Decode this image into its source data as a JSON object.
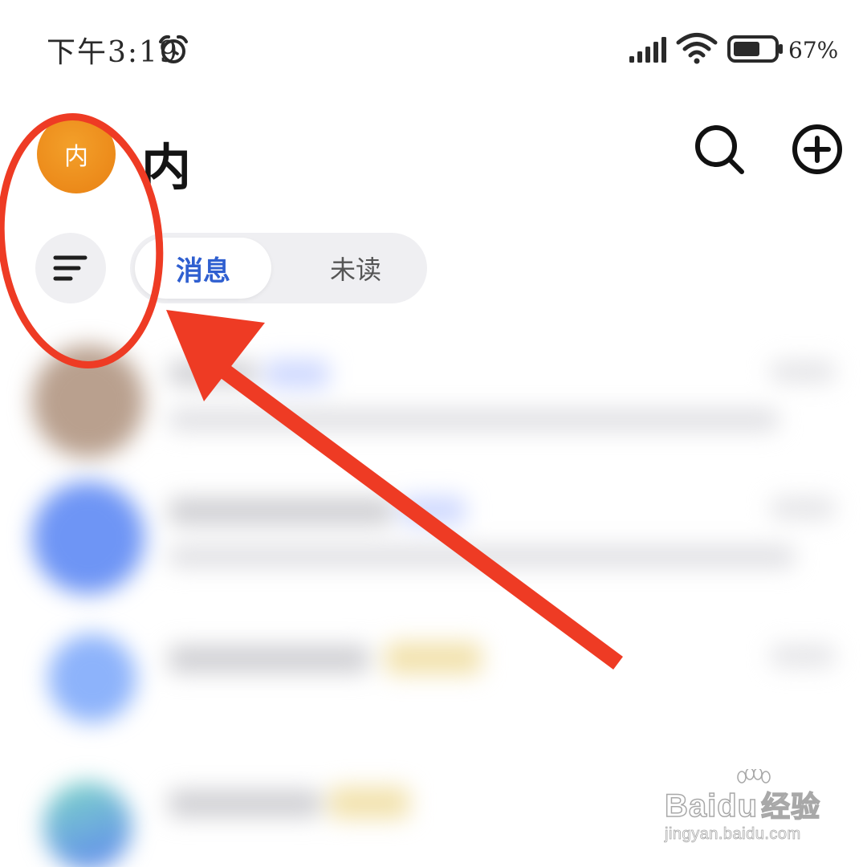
{
  "status_bar": {
    "time": "下午3:19",
    "battery": "67%",
    "icons": [
      "alarm-icon",
      "signal-icon",
      "wifi-icon",
      "battery-icon"
    ]
  },
  "header": {
    "avatar_text": "内",
    "title": "内",
    "actions": [
      "search-icon",
      "plus-circle-icon"
    ]
  },
  "filter": {
    "icon": "filter-lines-icon"
  },
  "tabs": [
    {
      "label": "消息",
      "active": true
    },
    {
      "label": "未读",
      "active": false
    }
  ],
  "message_list": {
    "blurred": true,
    "items": 4
  },
  "colors": {
    "avatar": "#ec8a1a",
    "tab_active_text": "#2f5fd0",
    "annotation": "#ee3b24"
  },
  "watermark": {
    "brand": "Baidu",
    "brand_cn": "经验",
    "url": "jingyan.baidu.com"
  }
}
